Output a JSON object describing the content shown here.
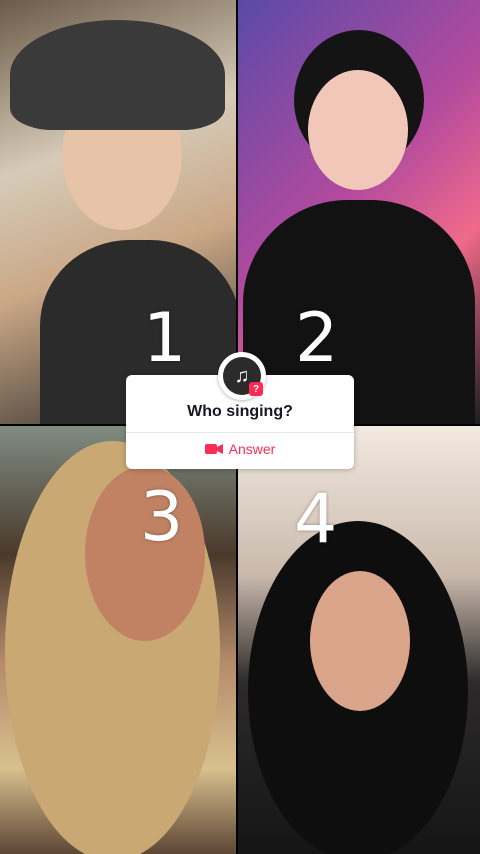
{
  "panels": [
    {
      "label": "1"
    },
    {
      "label": "2"
    },
    {
      "label": "3"
    },
    {
      "label": "4"
    }
  ],
  "question_card": {
    "question": "Who singing?",
    "answer_label": "Answer",
    "icons": {
      "avatar": "music-note-avatar-icon",
      "question_badge": "question-badge-icon",
      "answer_icon": "video-camera-icon"
    },
    "accent_color": "#fe2c55"
  }
}
